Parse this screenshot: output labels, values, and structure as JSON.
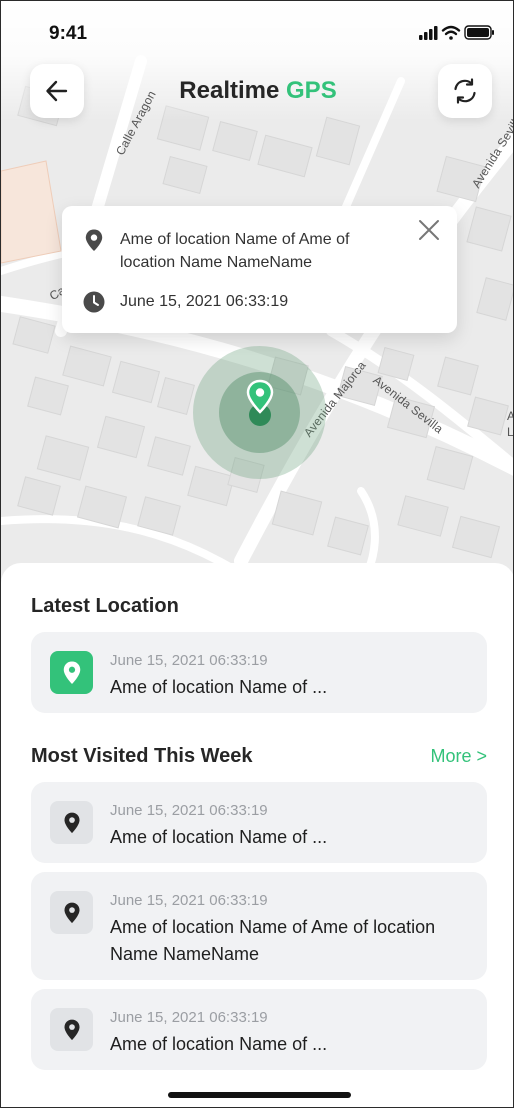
{
  "status_bar": {
    "time": "9:41",
    "icons": [
      "signal-icon",
      "wifi-icon",
      "battery-icon"
    ]
  },
  "header": {
    "title_main": "Realtime",
    "title_accent": "GPS",
    "back_icon": "arrow-left-icon",
    "refresh_icon": "refresh-icon"
  },
  "map": {
    "streets": [
      "Calle Aragon",
      "Avenida Majorca",
      "Avenida Sevilla",
      "Avenida Sevilla"
    ],
    "partial_labels": [
      "Ca",
      "A",
      "L"
    ]
  },
  "popup": {
    "location": "Ame of location Name of Ame of location Name NameName",
    "timestamp": "June 15, 2021  06:33:19",
    "location_icon": "location-pin-icon",
    "time_icon": "clock-icon",
    "close_icon": "close-icon"
  },
  "latest": {
    "title": "Latest Location",
    "item": {
      "date": "June 15, 2021  06:33:19",
      "name": "Ame of location Name of ..."
    }
  },
  "visited": {
    "title": "Most Visited This Week",
    "more_label": "More >",
    "items": [
      {
        "date": "June 15, 2021  06:33:19",
        "name": "Ame of location Name of ..."
      },
      {
        "date": "June 15, 2021  06:33:19",
        "name": "Ame of location Name of Ame of location Name NameName"
      },
      {
        "date": "June 15, 2021  06:33:19",
        "name": "Ame of location Name of ..."
      }
    ]
  },
  "colors": {
    "accent": "#33c27a",
    "card_bg": "#f1f2f4",
    "tile_bg": "#e1e3e6",
    "map_bg": "#ebebeb"
  }
}
